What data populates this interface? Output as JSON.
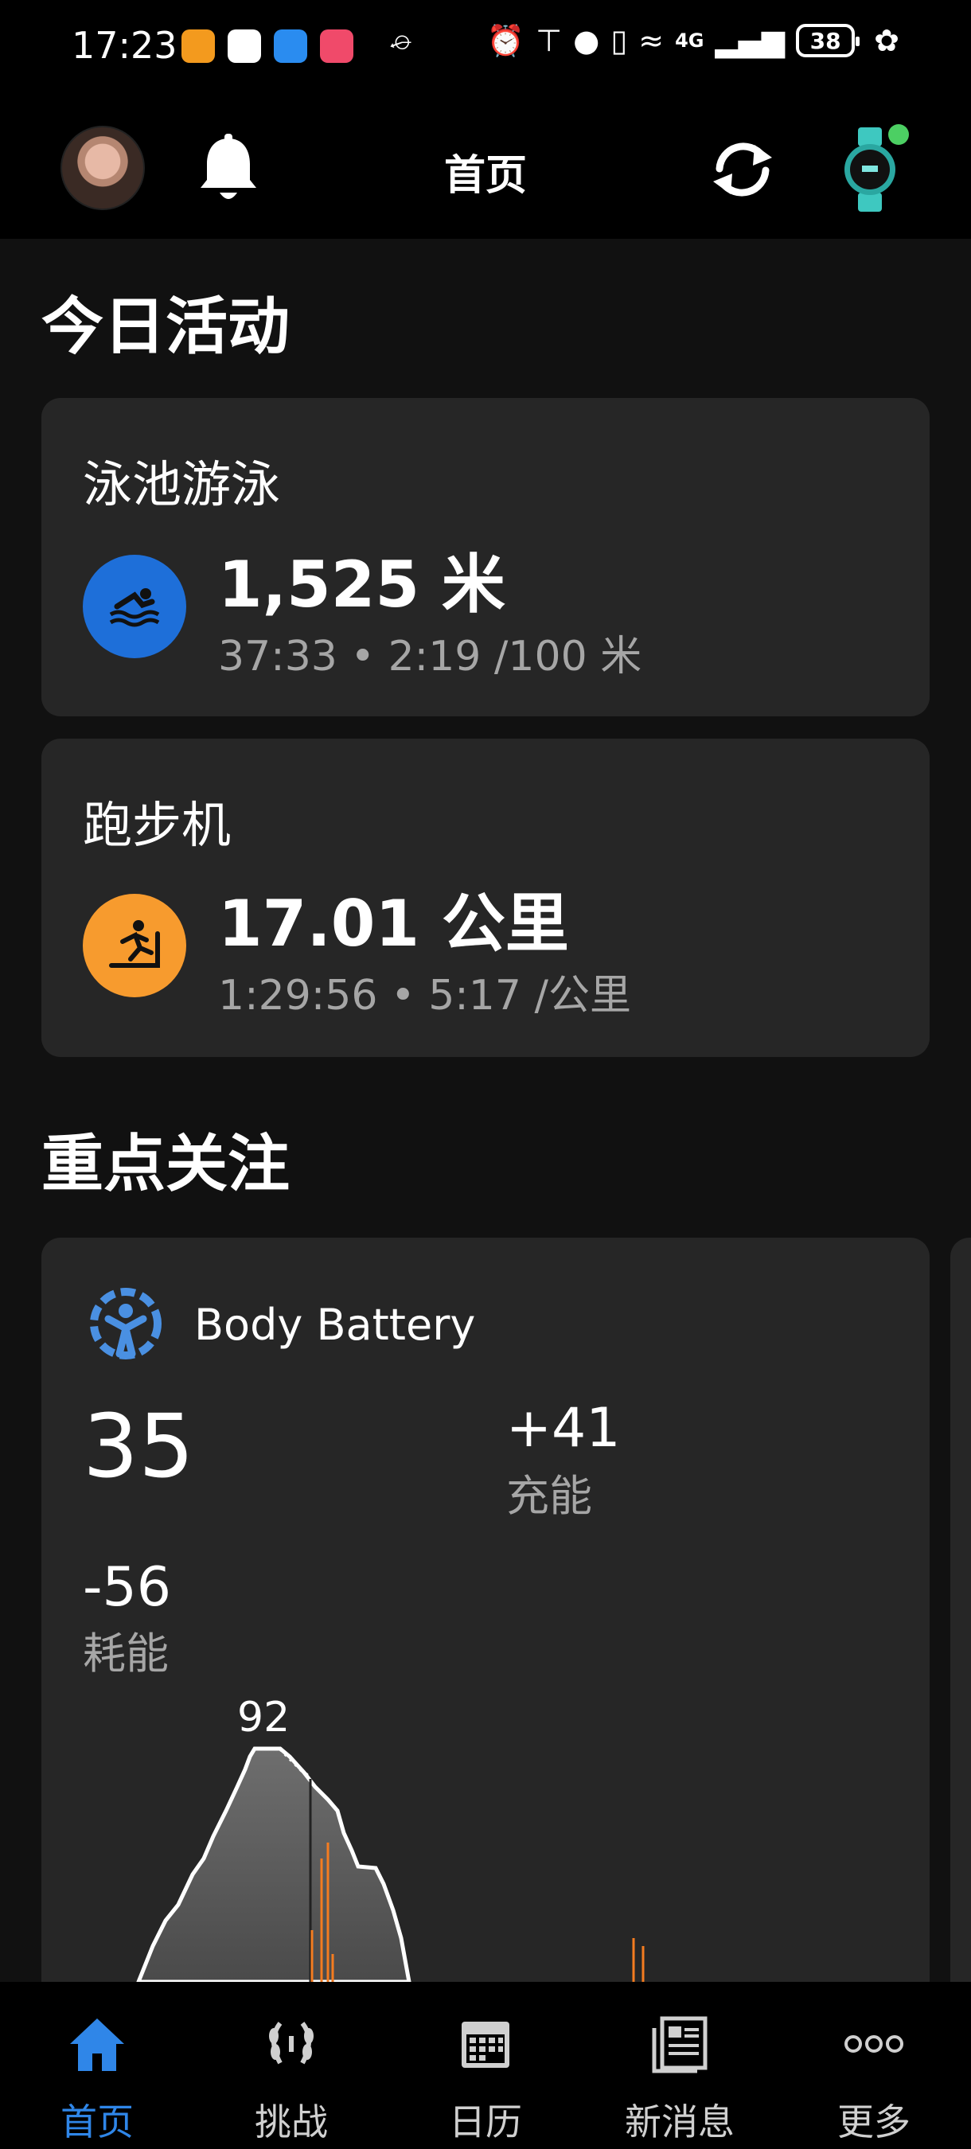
{
  "status_bar": {
    "time": "17:23",
    "battery": "38",
    "network": "4G",
    "icons": [
      "nfc-icon",
      "alarm-icon",
      "bluetooth-icon",
      "location-icon",
      "vibrate-icon",
      "wifi-icon",
      "signal-icon",
      "leaf-icon"
    ]
  },
  "header": {
    "title": "首页",
    "device_status_color": "#4ccf63"
  },
  "today": {
    "section_title": "今日活动",
    "activities": [
      {
        "name": "泳池游泳",
        "primary": "1,525 米",
        "secondary": "37:33 • 2:19 /100 米",
        "icon": "swimming-icon",
        "icon_color": "#1e6fd9"
      },
      {
        "name": "跑步机",
        "primary": "17.01 公里",
        "secondary": "1:29:56 • 5:17 /公里",
        "icon": "treadmill-icon",
        "icon_color": "#f79b2e"
      }
    ]
  },
  "highlights": {
    "section_title": "重点关注",
    "body_battery": {
      "title": "Body Battery",
      "value": "35",
      "charged_value": "+41",
      "charged_label": "充能",
      "drained_value": "-56",
      "drained_label": "耗能",
      "peak_label": "92",
      "accent_color": "#4a90e2",
      "spike_color": "#f47c20"
    }
  },
  "bottom_nav": {
    "active_color": "#2f86e8",
    "items": [
      {
        "label": "首页",
        "icon": "home-icon"
      },
      {
        "label": "挑战",
        "icon": "laurel-icon"
      },
      {
        "label": "日历",
        "icon": "calendar-icon"
      },
      {
        "label": "新消息",
        "icon": "newsfeed-icon"
      },
      {
        "label": "更多",
        "icon": "more-icon"
      }
    ]
  }
}
